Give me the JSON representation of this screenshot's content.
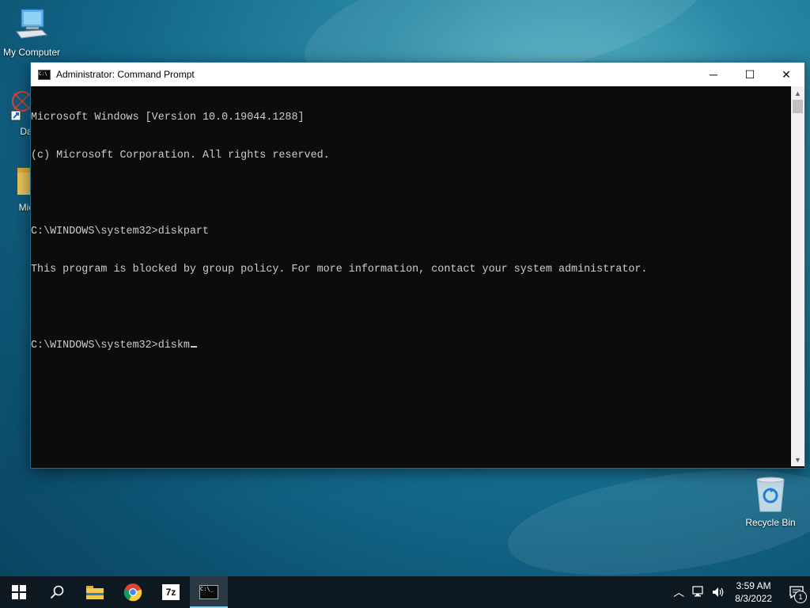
{
  "desktop": {
    "icons": [
      {
        "label": "My Computer"
      },
      {
        "label": "DataW"
      },
      {
        "label": "Micr"
      },
      {
        "label": "Recycle Bin"
      }
    ]
  },
  "window": {
    "title": "Administrator: Command Prompt",
    "controls": {
      "minimize": "─",
      "maximize": "☐",
      "close": "✕"
    },
    "console_lines": [
      "Microsoft Windows [Version 10.0.19044.1288]",
      "(c) Microsoft Corporation. All rights reserved.",
      "",
      "C:\\WINDOWS\\system32>diskpart",
      "This program is blocked by group policy. For more information, contact your system administrator.",
      "",
      "C:\\WINDOWS\\system32>diskm"
    ]
  },
  "taskbar": {
    "items": [
      {
        "icon": "windows-start-icon"
      },
      {
        "icon": "search-icon"
      },
      {
        "icon": "file-explorer-icon"
      },
      {
        "icon": "chrome-icon"
      },
      {
        "icon": "7zip-icon",
        "label": "7z"
      },
      {
        "icon": "command-prompt-icon",
        "active": true
      }
    ],
    "clock_time": "3:59 AM",
    "clock_date": "8/3/2022",
    "notification_count": "1"
  }
}
